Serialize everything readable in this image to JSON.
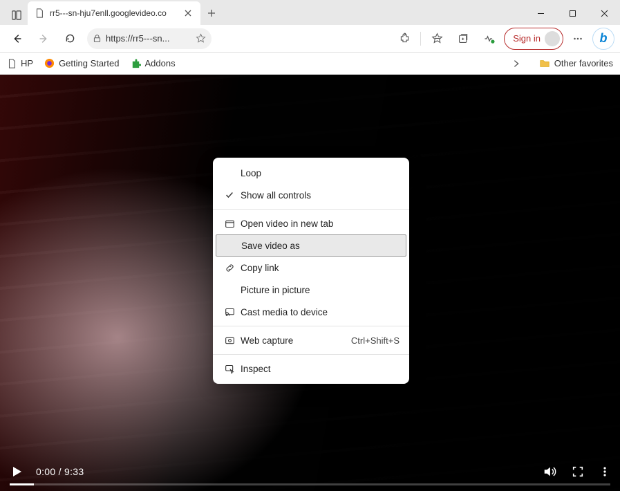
{
  "window": {
    "tab_title": "rr5---sn-hju7enll.googlevideo.co"
  },
  "toolbar": {
    "url": "https://rr5---sn...",
    "signin_label": "Sign in"
  },
  "bookmarks": {
    "items": [
      "HP",
      "Getting Started",
      "Addons"
    ],
    "other_favorites": "Other favorites"
  },
  "video": {
    "current_time": "0:00",
    "duration": "9:33",
    "time_display": "0:00 / 9:33"
  },
  "context_menu": {
    "items": [
      {
        "label": "Loop",
        "icon": ""
      },
      {
        "label": "Show all controls",
        "icon": "check"
      }
    ],
    "group2": [
      {
        "label": "Open video in new tab",
        "icon": "tab"
      },
      {
        "label": "Save video as",
        "icon": "",
        "highlight": true
      },
      {
        "label": "Copy link",
        "icon": "link"
      },
      {
        "label": "Picture in picture",
        "icon": ""
      },
      {
        "label": "Cast media to device",
        "icon": "cast"
      }
    ],
    "group3": [
      {
        "label": "Web capture",
        "icon": "capture",
        "shortcut": "Ctrl+Shift+S"
      }
    ],
    "group4": [
      {
        "label": "Inspect",
        "icon": "inspect"
      }
    ]
  }
}
